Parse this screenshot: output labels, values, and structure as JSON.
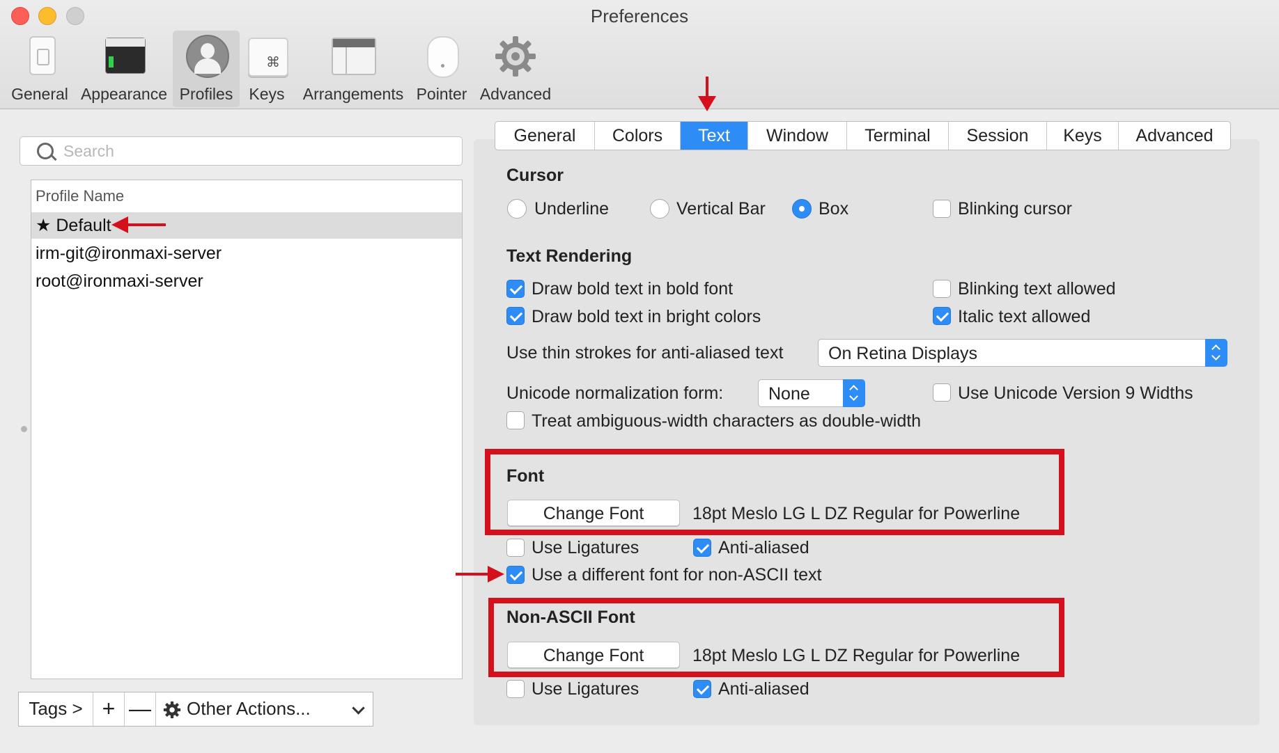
{
  "window": {
    "title": "Preferences"
  },
  "toolbar": {
    "items": [
      {
        "label": "General",
        "icon": "general-icon"
      },
      {
        "label": "Appearance",
        "icon": "appearance-icon"
      },
      {
        "label": "Profiles",
        "icon": "profiles-icon",
        "selected": true
      },
      {
        "label": "Keys",
        "icon": "keys-icon"
      },
      {
        "label": "Arrangements",
        "icon": "arrangements-icon"
      },
      {
        "label": "Pointer",
        "icon": "pointer-icon"
      },
      {
        "label": "Advanced",
        "icon": "gear-icon"
      }
    ]
  },
  "sidebar": {
    "search_placeholder": "Search",
    "column_header": "Profile Name",
    "profiles": [
      {
        "label": "★ Default",
        "selected": true
      },
      {
        "label": "irm-git@ironmaxi-server"
      },
      {
        "label": "root@ironmaxi-server"
      }
    ],
    "bottom": {
      "tags_label": "Tags >",
      "add_label": "+",
      "remove_label": "—",
      "other_actions_label": "Other Actions..."
    }
  },
  "tabs": {
    "items": [
      "General",
      "Colors",
      "Text",
      "Window",
      "Terminal",
      "Session",
      "Keys",
      "Advanced"
    ],
    "selected": "Text"
  },
  "cursor": {
    "heading": "Cursor",
    "options": [
      "Underline",
      "Vertical Bar",
      "Box"
    ],
    "selected": "Box",
    "blinking_label": "Blinking cursor",
    "blinking": false
  },
  "text_rendering": {
    "heading": "Text Rendering",
    "bold_font_label": "Draw bold text in bold font",
    "bold_font": true,
    "bright_colors_label": "Draw bold text in bright colors",
    "bright_colors": true,
    "blinking_text_label": "Blinking text allowed",
    "blinking_text": false,
    "italic_label": "Italic text allowed",
    "italic": true,
    "thin_strokes_label": "Use thin strokes for anti-aliased text",
    "thin_strokes_value": "On Retina Displays",
    "unicode_norm_label": "Unicode normalization form:",
    "unicode_norm_value": "None",
    "unicode9_label": "Use Unicode Version 9 Widths",
    "unicode9": false,
    "ambiguous_label": "Treat ambiguous-width characters as double-width",
    "ambiguous": false
  },
  "font": {
    "heading": "Font",
    "change_label": "Change Font",
    "current": "18pt Meslo LG L DZ Regular for Powerline",
    "ligatures_label": "Use Ligatures",
    "ligatures": false,
    "antialiased_label": "Anti-aliased",
    "antialiased": true,
    "different_font_label": "Use a different font for non-ASCII text",
    "different_font": true
  },
  "non_ascii_font": {
    "heading": "Non-ASCII Font",
    "change_label": "Change Font",
    "current": "18pt Meslo LG L DZ Regular for Powerline",
    "ligatures_label": "Use Ligatures",
    "ligatures": false,
    "antialiased_label": "Anti-aliased",
    "antialiased": true
  },
  "colors": {
    "accent": "#2d8cf5",
    "annotation": "#d4101d"
  }
}
